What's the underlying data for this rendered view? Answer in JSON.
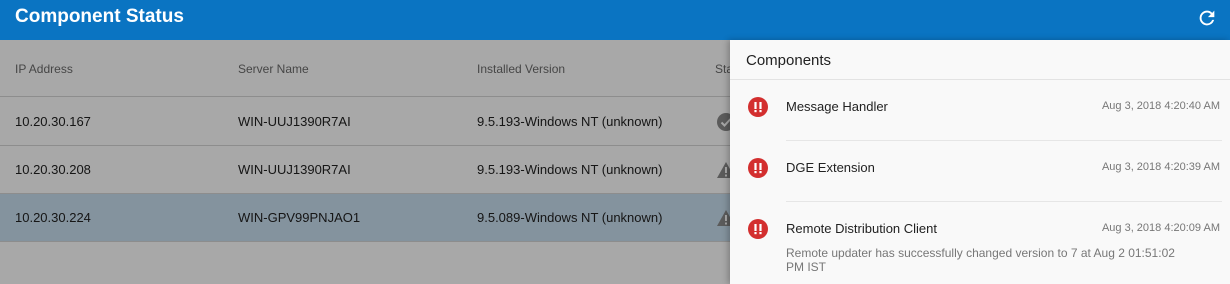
{
  "header": {
    "title": "Component Status",
    "refresh_icon": "refresh-icon"
  },
  "table": {
    "columns": [
      "IP Address",
      "Server Name",
      "Installed Version",
      "Status"
    ],
    "rows": [
      {
        "ip": "10.20.30.167",
        "server": "WIN-UUJ1390R7AI",
        "version": "9.5.193-Windows NT (unknown)",
        "status_icon": "check-circle-icon"
      },
      {
        "ip": "10.20.30.208",
        "server": "WIN-UUJ1390R7AI",
        "version": "9.5.193-Windows NT (unknown)",
        "status_icon": "warning-icon"
      },
      {
        "ip": "10.20.30.224",
        "server": "WIN-GPV99PNJAO1",
        "version": "9.5.089-Windows NT (unknown)",
        "status_icon": "warning-icon",
        "selected": true
      }
    ]
  },
  "panel": {
    "title": "Components",
    "items": [
      {
        "name": "Message Handler",
        "time": "Aug 3, 2018 4:20:40 AM",
        "icon": "error-icon"
      },
      {
        "name": "DGE Extension",
        "time": "Aug 3, 2018 4:20:39 AM",
        "icon": "error-icon"
      },
      {
        "name": "Remote Distribution Client",
        "time": "Aug 3, 2018 4:20:09 AM",
        "icon": "error-icon",
        "message": "Remote updater has successfully changed version to 7 at Aug 2 01:51:02 PM IST"
      }
    ]
  },
  "colors": {
    "header_bg": "#0a74c2",
    "error": "#d32f2f",
    "selected_row": "#c9dff0"
  }
}
